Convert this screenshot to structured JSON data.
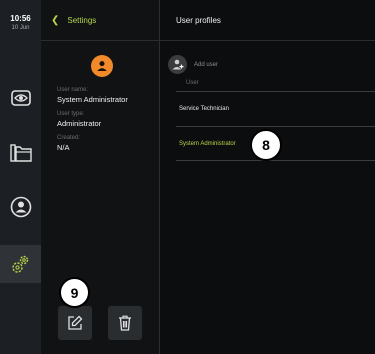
{
  "status": {
    "time": "10:56",
    "date": "10 Jun"
  },
  "rail": {
    "items": [
      {
        "icon": "eye-icon",
        "active": false
      },
      {
        "icon": "files-icon",
        "active": false
      },
      {
        "icon": "user-account-icon",
        "active": false
      },
      {
        "icon": "settings-gears-icon",
        "active": true
      }
    ]
  },
  "settings_panel": {
    "back_icon": "chevron-left-icon",
    "title": "Settings",
    "avatar_icon": "user-icon",
    "user_name_label": "User name:",
    "user_name_value": "System Administrator",
    "user_type_label": "User type:",
    "user_type_value": "Administrator",
    "created_label": "Created:",
    "created_value": "N/A",
    "edit_icon": "edit-icon",
    "delete_icon": "trash-icon"
  },
  "profiles_panel": {
    "title": "User profiles",
    "add_user_label": "Add user",
    "add_user_icon": "add-user-icon",
    "list_header": "User",
    "users": [
      {
        "name": "Service Technician",
        "selected": false
      },
      {
        "name": "System Administrator",
        "selected": true
      }
    ]
  },
  "markers": {
    "edit": "9",
    "list": "8"
  },
  "colors": {
    "accent": "#b8d64a",
    "avatar": "#f08a2b",
    "rail": "#1c2024",
    "panel": "#101214"
  }
}
